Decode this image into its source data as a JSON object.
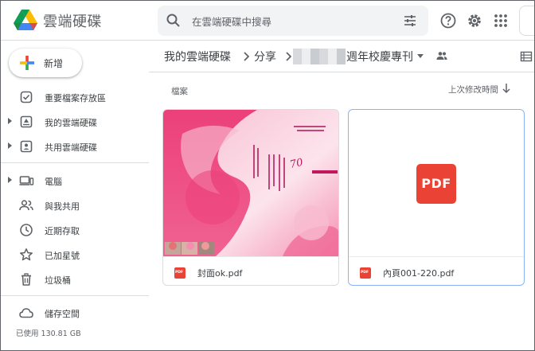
{
  "app": {
    "title": "雲端硬碟"
  },
  "search": {
    "placeholder": "在雲端硬碟中搜尋"
  },
  "sidebar": {
    "new_label": "新增",
    "items": [
      {
        "label": "重要檔案存放區",
        "icon": "priority-check-icon",
        "caret": false
      },
      {
        "label": "我的雲端硬碟",
        "icon": "my-drive-icon",
        "caret": true
      },
      {
        "label": "共用雲端硬碟",
        "icon": "shared-drives-icon",
        "caret": true
      },
      {
        "label": "電腦",
        "icon": "computers-icon",
        "caret": true
      },
      {
        "label": "與我共用",
        "icon": "shared-with-me-icon",
        "caret": false
      },
      {
        "label": "近期存取",
        "icon": "recent-clock-icon",
        "caret": false
      },
      {
        "label": "已加星號",
        "icon": "star-icon",
        "caret": false
      },
      {
        "label": "垃圾桶",
        "icon": "trash-icon",
        "caret": false
      },
      {
        "label": "儲存空間",
        "icon": "cloud-icon",
        "caret": false
      }
    ],
    "storage_used": "已使用 130.81 GB"
  },
  "breadcrumb": {
    "root": "我的雲端硬碟",
    "share": "分享",
    "folder": "週年校慶專刊"
  },
  "main": {
    "section_label": "檔案",
    "sort_label": "上次修改時間"
  },
  "files": [
    {
      "name": "封面ok.pdf",
      "type_badge": "PDF"
    },
    {
      "name": "內頁001-220.pdf",
      "type_badge": "PDF"
    }
  ],
  "cover_thumb": {
    "seventy": "70"
  },
  "colors": {
    "accent_blue": "#1a73e8",
    "pdf_red": "#ea4335",
    "pink": "#f06292",
    "border": "#dadce0"
  }
}
